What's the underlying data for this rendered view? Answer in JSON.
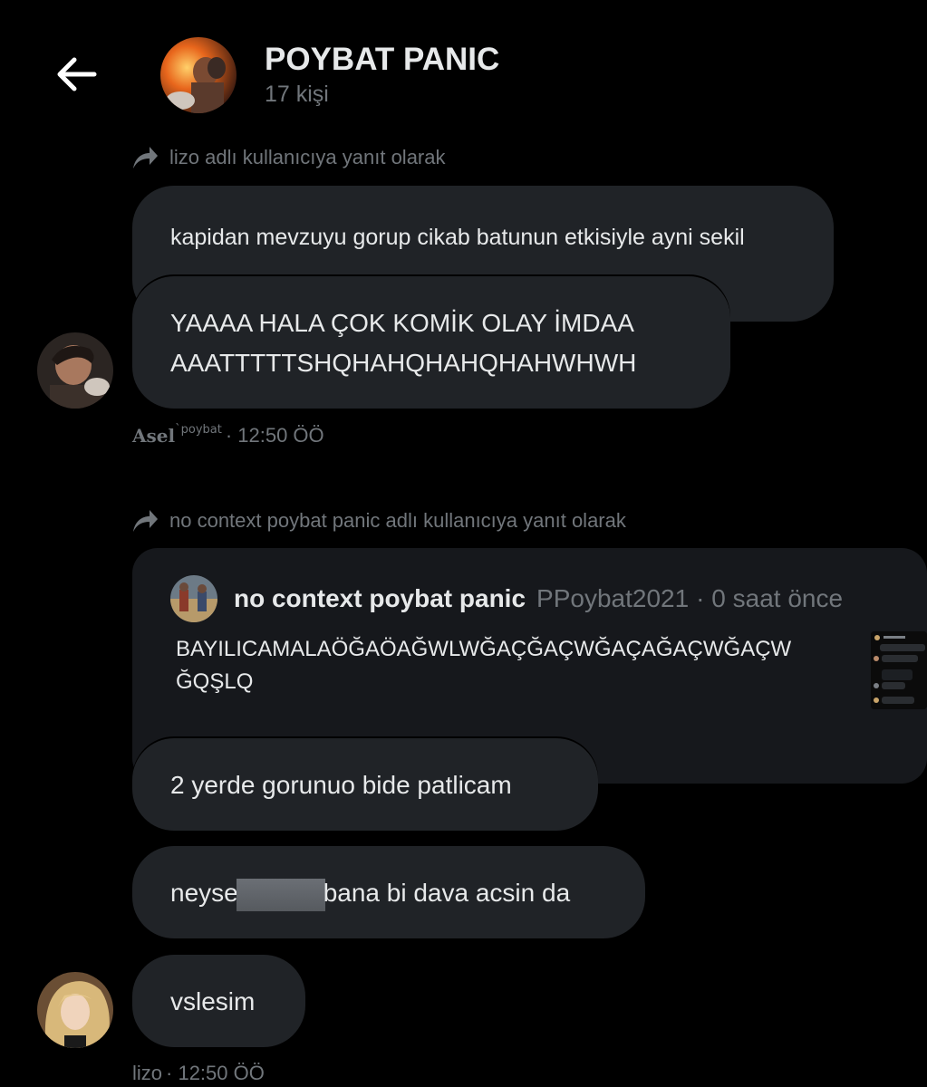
{
  "header": {
    "title": "POYBAT PANIC",
    "subtitle": "17 kişi"
  },
  "messages": {
    "reply1": {
      "text": "lizo adlı kullanıcıya yanıt olarak"
    },
    "m1": {
      "text": "kapidan mevzuyu gorup cikab batunun etkisiyle ayni sekil"
    },
    "m2": {
      "text": "YAAAA HALA ÇOK KOMİK OLAY İMDAA\nAAATTTTTSHQHAHQHAHQHAHWHWH"
    },
    "meta1": {
      "name": "Asel",
      "name_super": "`poybat",
      "time": "· 12:50 ÖÖ"
    },
    "reply2": {
      "text": "no context poybat panic adlı kullanıcıya yanıt olarak"
    },
    "quote": {
      "name": "no context poybat panic",
      "handle": "PPoybat2021",
      "time": "· 0 saat önce",
      "text": "BAYILICAMALAÖĞAÖAĞWLWĞAÇĞAÇWĞAÇAĞAÇWĞAÇW\nĞQŞLQ"
    },
    "m3": {
      "text": "2 yerde gorunuo bide patlicam"
    },
    "m4": {
      "text_before": "neyse",
      "text_after": "bana bi dava acsin da"
    },
    "m5": {
      "text": "vslesim"
    },
    "meta2": {
      "name": "lizo",
      "time": "· 12:50 ÖÖ"
    }
  },
  "colors": {
    "background": "#000000",
    "bubble": "#202327",
    "quote_bg": "#16181c",
    "primary_text": "#e7e9ea",
    "secondary_text": "#71767b"
  },
  "icons": {
    "back": "arrow-left-icon",
    "reply": "reply-arrow-icon"
  }
}
